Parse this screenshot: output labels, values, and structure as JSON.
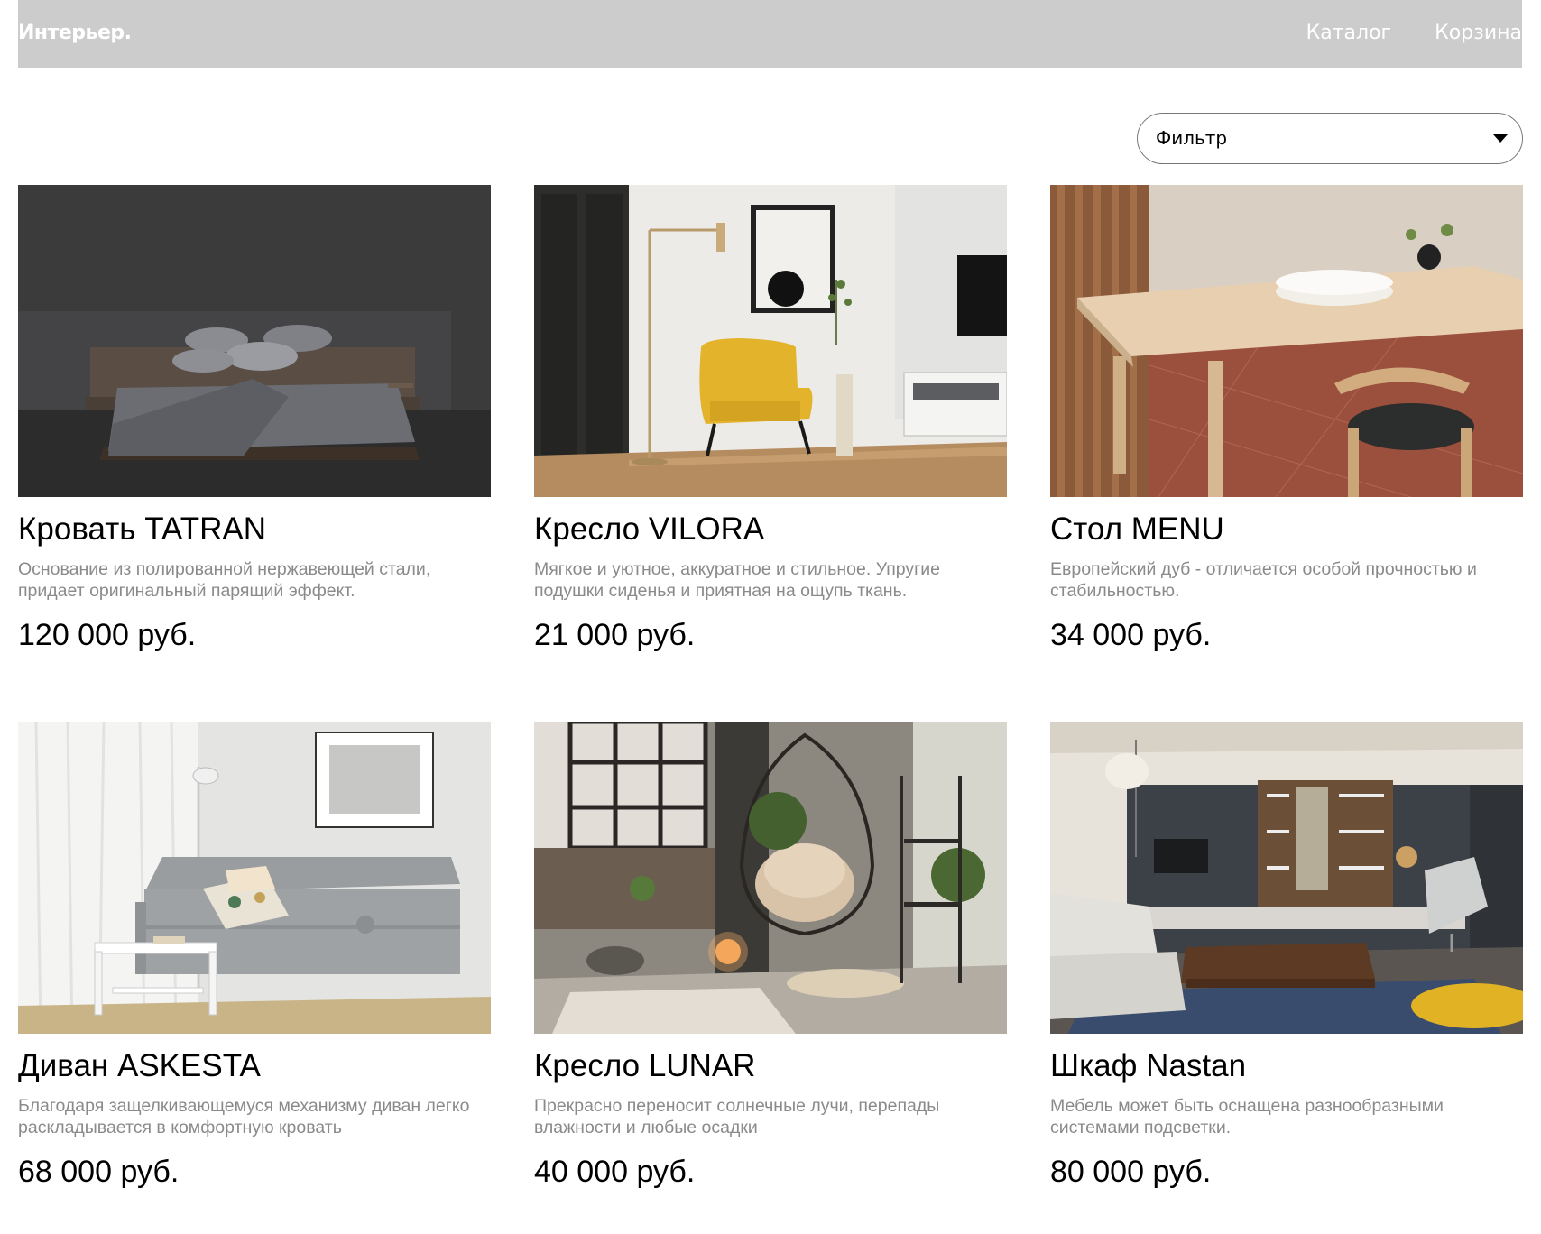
{
  "header": {
    "logo": "Интерьер.",
    "nav": [
      "Каталог",
      "Корзина"
    ]
  },
  "filter": {
    "label": "Фильтр"
  },
  "products": [
    {
      "title": "Кровать TATRAN",
      "description": "Основание из полированной нержавеющей стали, придает оригинальный парящий эффект.",
      "price": "120 000 руб."
    },
    {
      "title": "Кресло VILORA",
      "description": "Мягкое и уютное, аккуратное и стильное. Упругие подушки сиденья и приятная на ощупь ткань.",
      "price": "21 000 руб."
    },
    {
      "title": "Стол MENU",
      "description": "Европейский дуб - отличается особой прочностью и стабильностью.",
      "price": "34 000 руб."
    },
    {
      "title": "Диван ASKESTA",
      "description": "Благодаря защелкивающемуся механизму диван легко раскладывается в комфортную кровать",
      "price": "68 000 руб."
    },
    {
      "title": "Кресло LUNAR",
      "description": "Прекрасно переносит солнечные лучи, перепады влажности и любые осадки",
      "price": "40 000 руб."
    },
    {
      "title": "Шкаф Nastan",
      "description": "Мебель может быть оснащена разнообразными системами подсветки.",
      "price": "80 000 руб."
    }
  ]
}
